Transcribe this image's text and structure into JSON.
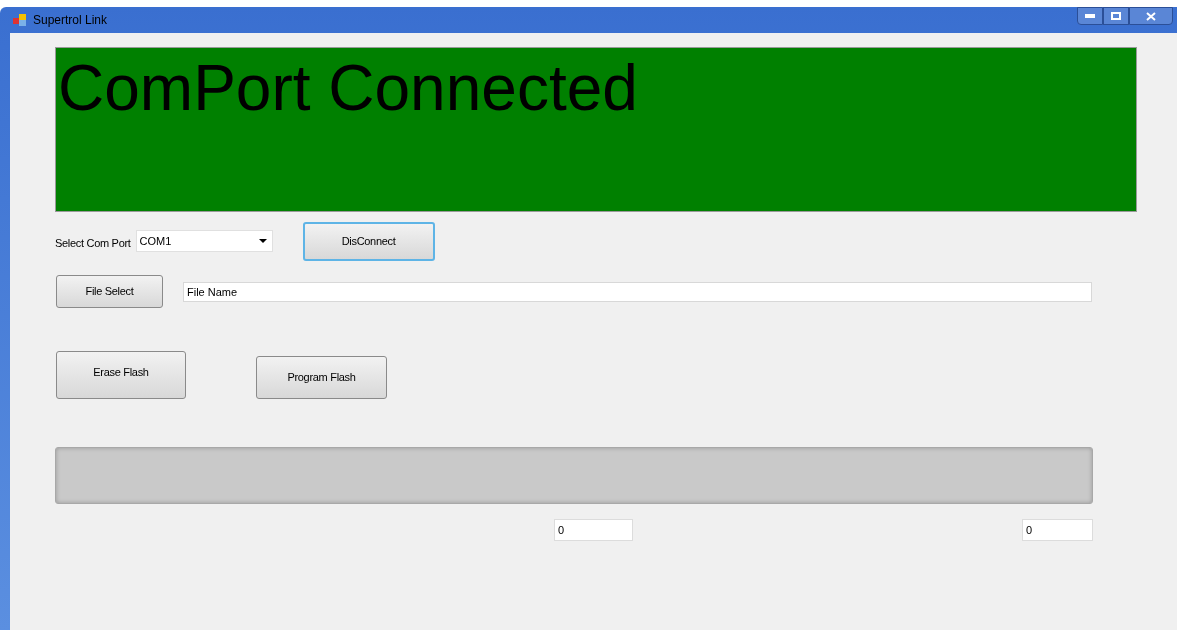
{
  "window": {
    "title": "Supertrol Link"
  },
  "status_banner": {
    "text": "ComPort Connected",
    "kind": "connected"
  },
  "com_port": {
    "label": "Select Com Port",
    "value": "COM1"
  },
  "connect_button": {
    "label": "DisConnect",
    "focused": true
  },
  "file_select_button": {
    "label": "File Select"
  },
  "file_name": {
    "value": "File Name"
  },
  "erase_button": {
    "label": "Erase Flash"
  },
  "program_button": {
    "label": "Program Flash"
  },
  "progress": {
    "level": 0
  },
  "counters": [
    {
      "value": "0"
    },
    {
      "value": "0"
    }
  ]
}
